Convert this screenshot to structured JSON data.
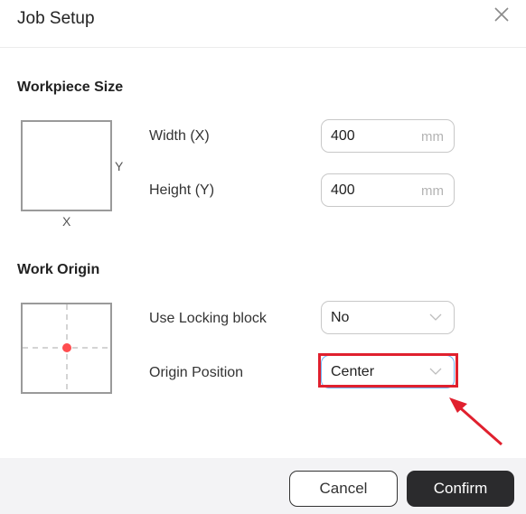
{
  "dialog": {
    "title": "Job Setup",
    "close_icon": "close-icon"
  },
  "workpiece_size": {
    "heading": "Workpiece Size",
    "diagram": {
      "x_axis_label": "X",
      "y_axis_label": "Y"
    },
    "width": {
      "label": "Width (X)",
      "value": "400",
      "unit": "mm"
    },
    "height": {
      "label": "Height (Y)",
      "value": "400",
      "unit": "mm"
    }
  },
  "work_origin": {
    "heading": "Work Origin",
    "diagram": {
      "origin_marker": "center",
      "marker_color": "#ff4d4f"
    },
    "locking_block": {
      "label": "Use Locking block",
      "selected": "No"
    },
    "origin_position": {
      "label": "Origin Position",
      "selected": "Center"
    }
  },
  "annotation": {
    "highlight_color": "#e0202e",
    "arrow_color": "#e0202e",
    "target": "origin-position-select"
  },
  "footer": {
    "cancel_label": "Cancel",
    "confirm_label": "Confirm"
  }
}
